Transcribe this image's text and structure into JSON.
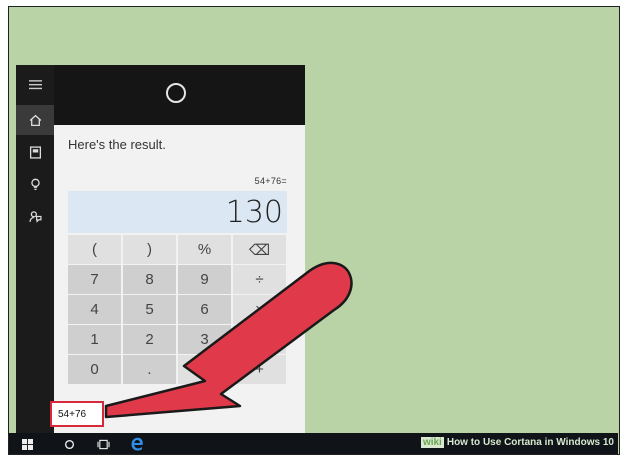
{
  "cortana": {
    "heading": "Here's the result.",
    "expression": "54+76=",
    "result": "130",
    "keys": [
      {
        "label": "(",
        "name": "key-open-paren"
      },
      {
        "label": ")",
        "name": "key-close-paren"
      },
      {
        "label": "%",
        "name": "key-percent"
      },
      {
        "label": "⌫",
        "name": "key-backspace"
      },
      {
        "label": "7",
        "name": "key-7"
      },
      {
        "label": "8",
        "name": "key-8"
      },
      {
        "label": "9",
        "name": "key-9"
      },
      {
        "label": "÷",
        "name": "key-divide"
      },
      {
        "label": "4",
        "name": "key-4"
      },
      {
        "label": "5",
        "name": "key-5"
      },
      {
        "label": "6",
        "name": "key-6"
      },
      {
        "label": "×",
        "name": "key-multiply"
      },
      {
        "label": "1",
        "name": "key-1"
      },
      {
        "label": "2",
        "name": "key-2"
      },
      {
        "label": "3",
        "name": "key-3"
      },
      {
        "label": "−",
        "name": "key-minus"
      },
      {
        "label": "0",
        "name": "key-0"
      },
      {
        "label": ".",
        "name": "key-decimal"
      },
      {
        "label": "=",
        "name": "key-equals"
      },
      {
        "label": "+",
        "name": "key-plus"
      }
    ],
    "search_value": "54+76"
  },
  "rail": {
    "icons": [
      "hamburger-icon",
      "home-icon",
      "notebook-icon",
      "lightbulb-icon",
      "feedback-icon"
    ]
  },
  "taskbar": {
    "icons": [
      "windows-start-icon",
      "cortana-circle-icon",
      "task-view-icon",
      "edge-browser-icon"
    ]
  },
  "watermark": {
    "wiki": "wiki",
    "text": "How to Use Cortana in Windows 10"
  },
  "colors": {
    "desktop": "#b9d2a6",
    "highlight": "#d62a3a",
    "arrow": "#e03a4a",
    "display": "#dbe7f3"
  }
}
